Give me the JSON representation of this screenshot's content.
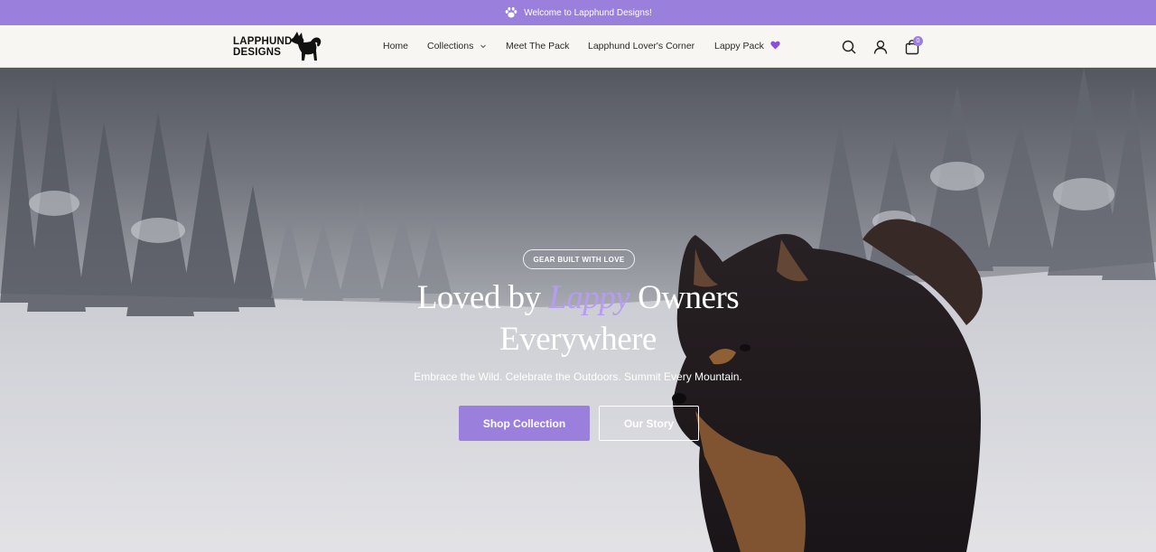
{
  "announcement": {
    "text": "Welcome to Lapphund Designs!",
    "icon": "paw-icon"
  },
  "logo": {
    "line1": "LAPPHUND",
    "line2": "DESIGNS"
  },
  "nav": {
    "items": [
      {
        "label": "Home"
      },
      {
        "label": "Collections",
        "icon": "chevron-down-icon"
      },
      {
        "label": "Meet The Pack"
      },
      {
        "label": "Lapphund Lover's Corner"
      },
      {
        "label": "Lappy Pack",
        "icon": "heart-icon"
      }
    ]
  },
  "header_icons": {
    "search": "search-icon",
    "account": "user-icon",
    "cart": "cart-icon",
    "cart_count": "0"
  },
  "hero": {
    "eyebrow": "GEAR BUILT WITH LOVE",
    "headline_pre": "Loved by ",
    "headline_accent": "Lappy",
    "headline_post": " Owners",
    "headline_line2": "Everywhere",
    "subtitle": "Embrace the Wild. Celebrate the Outdoors. Summit Every Mountain.",
    "primary_cta": "Shop Collection",
    "secondary_cta": "Our Story"
  },
  "colors": {
    "accent": "#9b7fdc",
    "header_bg": "#f7f6f2",
    "text": "#2a2a2a"
  }
}
